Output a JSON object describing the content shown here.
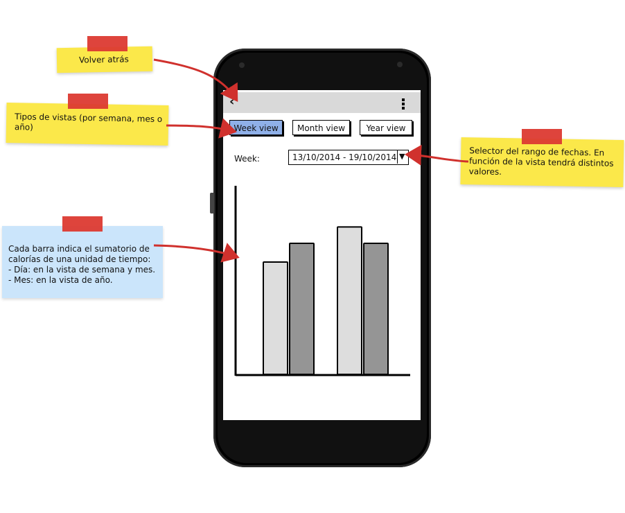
{
  "annotations": {
    "back_note": "Volver atrás",
    "views_note": "Tipos de vistas (por semana, mes o año)",
    "range_note": "Selector del rango de fechas. En función de la vista tendrá distintos valores.",
    "bars_note": "Cada barra indica el sumatorio de calorías de una unidad de tiempo:\n  - Día: en la vista de semana y mes.\n  - Mes: en la vista de año."
  },
  "app": {
    "back_icon": "back-arrow-icon",
    "menu_icon": "overflow-menu-icon",
    "tabs": [
      {
        "label": "Week view",
        "active": true
      },
      {
        "label": "Month view",
        "active": false
      },
      {
        "label": "Year view",
        "active": false
      }
    ],
    "range": {
      "label": "Week:",
      "value": "13/10/2014 - 19/10/2014",
      "arrow_icon": "dropdown-arrow-icon"
    }
  },
  "chart_data": {
    "type": "bar",
    "title": "",
    "xlabel": "",
    "ylabel": "",
    "categories": [
      "",
      "",
      "",
      ""
    ],
    "values": [
      0.48,
      0.56,
      0.63,
      0.56
    ],
    "ylim": [
      0,
      0.8
    ],
    "bar_colors": [
      "#dddddd",
      "#959595",
      "#dddddd",
      "#959595"
    ],
    "grid": false
  },
  "colors": {
    "active_tab": "#8fb0e8",
    "note_yellow": "#fbe84a",
    "note_blue": "#cbe5fb",
    "arrow_red": "#d0312d"
  }
}
